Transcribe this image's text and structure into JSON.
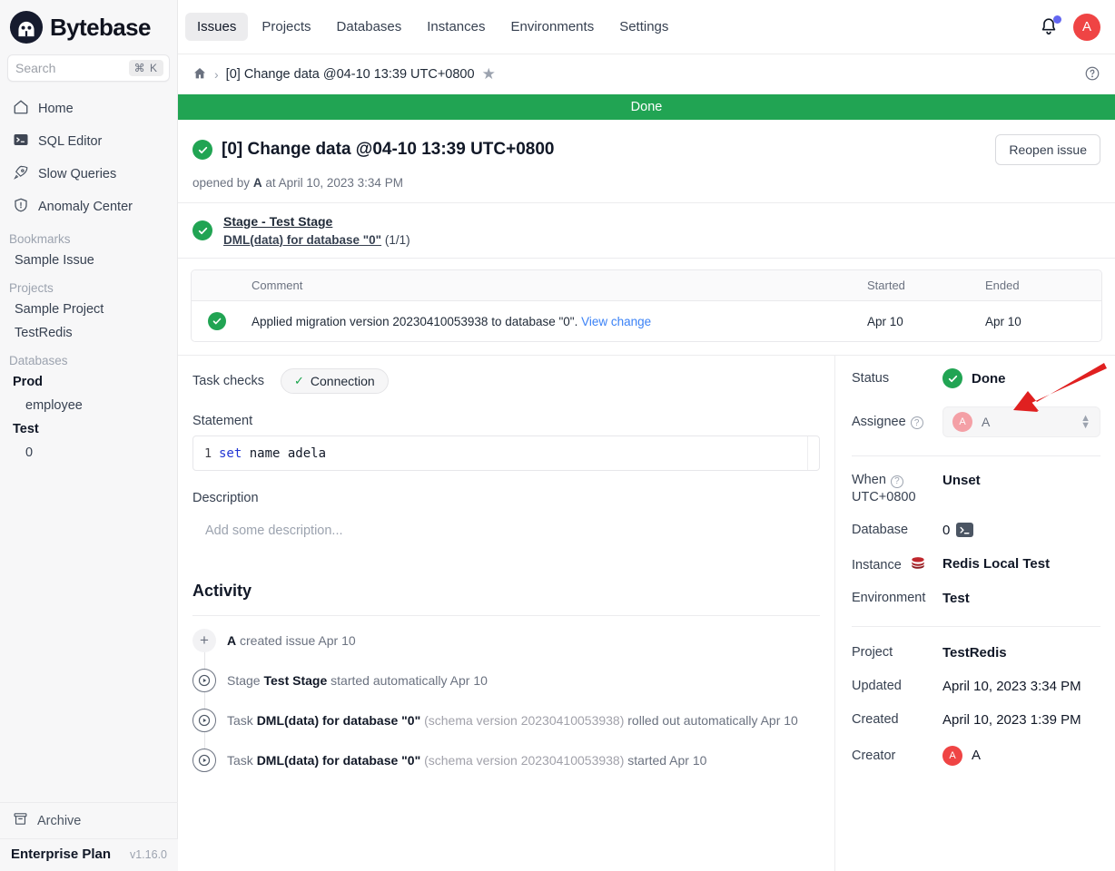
{
  "brand": {
    "name": "Bytebase",
    "logo_icon": "bytebase-logo-icon"
  },
  "search": {
    "placeholder": "Search",
    "shortcut": "⌘ K"
  },
  "sidebar": {
    "nav": [
      {
        "label": "Home",
        "icon": "home-icon"
      },
      {
        "label": "SQL Editor",
        "icon": "terminal-icon"
      },
      {
        "label": "Slow Queries",
        "icon": "rocket-icon"
      },
      {
        "label": "Anomaly Center",
        "icon": "shield-icon"
      }
    ],
    "sections": [
      {
        "title": "Bookmarks",
        "items": [
          {
            "label": "Sample Issue",
            "bold": false,
            "indent": 1
          }
        ]
      },
      {
        "title": "Projects",
        "items": [
          {
            "label": "Sample Project",
            "bold": false,
            "indent": 1
          },
          {
            "label": "TestRedis",
            "bold": false,
            "indent": 1
          }
        ]
      },
      {
        "title": "Databases",
        "items": [
          {
            "label": "Prod",
            "bold": true,
            "indent": 0
          },
          {
            "label": "employee",
            "bold": false,
            "indent": 2
          },
          {
            "label": "Test",
            "bold": true,
            "indent": 0
          },
          {
            "label": "0",
            "bold": false,
            "indent": 2
          }
        ]
      }
    ],
    "archive": {
      "label": "Archive",
      "icon": "archive-icon"
    },
    "plan": {
      "name": "Enterprise Plan",
      "version": "v1.16.0"
    }
  },
  "topnav": {
    "tabs": [
      {
        "label": "Issues",
        "active": true
      },
      {
        "label": "Projects",
        "active": false
      },
      {
        "label": "Databases",
        "active": false
      },
      {
        "label": "Instances",
        "active": false
      },
      {
        "label": "Environments",
        "active": false
      },
      {
        "label": "Settings",
        "active": false
      }
    ],
    "bell_icon": "bell-icon",
    "avatar_initial": "A"
  },
  "breadcrumb": {
    "home_icon": "home-icon",
    "separator": "›",
    "title": "[0] Change data @04-10 13:39 UTC+0800",
    "star_icon": "star-icon",
    "help_icon": "help-circle-icon"
  },
  "issue": {
    "status_banner": "Done",
    "title": "[0] Change data @04-10 13:39 UTC+0800",
    "reopen_label": "Reopen issue",
    "opened_prefix": "opened by",
    "opened_author": "A",
    "opened_suffix": "at April 10, 2023 3:34 PM"
  },
  "stage": {
    "link": "Stage - Test Stage",
    "task_link": "DML(data) for database \"0\"",
    "task_count": "(1/1)"
  },
  "task_table": {
    "headers": {
      "comment": "Comment",
      "started": "Started",
      "ended": "Ended"
    },
    "rows": [
      {
        "comment": "Applied migration version 20230410053938 to database \"0\".",
        "link": "View change",
        "started": "Apr 10",
        "ended": "Apr 10"
      }
    ]
  },
  "details": {
    "task_checks_label": "Task checks",
    "connection_pill": "Connection",
    "statement_label": "Statement",
    "statement_line_no": "1",
    "statement_keyword": "set",
    "statement_rest": " name adela",
    "description_label": "Description",
    "description_placeholder": "Add some description..."
  },
  "activity": {
    "title": "Activity",
    "items": [
      {
        "icon": "plus-icon",
        "author": "A",
        "text": " created issue Apr 10"
      },
      {
        "icon": "play-circle-icon",
        "prefix": "Stage ",
        "bold": "Test Stage",
        "text": " started automatically Apr 10"
      },
      {
        "icon": "play-circle-icon",
        "prefix": "Task ",
        "bold": "DML(data) for database \"0\"",
        "mute": " (schema version 20230410053938)",
        "text": " rolled out automatically Apr 10"
      },
      {
        "icon": "play-circle-icon",
        "prefix": "Task ",
        "bold": "DML(data) for database \"0\"",
        "mute": " (schema version 20230410053938)",
        "text": " started Apr 10"
      }
    ]
  },
  "right_panel": {
    "status_label": "Status",
    "status_value": "Done",
    "assignee_label": "Assignee",
    "assignee_initial": "A",
    "assignee_name": "A",
    "when_label": "When",
    "when_tz": "UTC+0800",
    "when_value": "Unset",
    "database_label": "Database",
    "database_value": "0",
    "database_sql_icon": "terminal-icon",
    "instance_label": "Instance",
    "instance_icon": "redis-icon",
    "instance_value": "Redis Local Test",
    "environment_label": "Environment",
    "environment_value": "Test",
    "project_label": "Project",
    "project_value": "TestRedis",
    "updated_label": "Updated",
    "updated_value": "April 10, 2023 3:34 PM",
    "created_label": "Created",
    "created_value": "April 10, 2023 1:39 PM",
    "creator_label": "Creator",
    "creator_initial": "A",
    "creator_name": "A"
  },
  "colors": {
    "green": "#21a453",
    "accent_red": "#ef4444",
    "link_blue": "#3b82f6",
    "annotation_red": "#e02020"
  }
}
